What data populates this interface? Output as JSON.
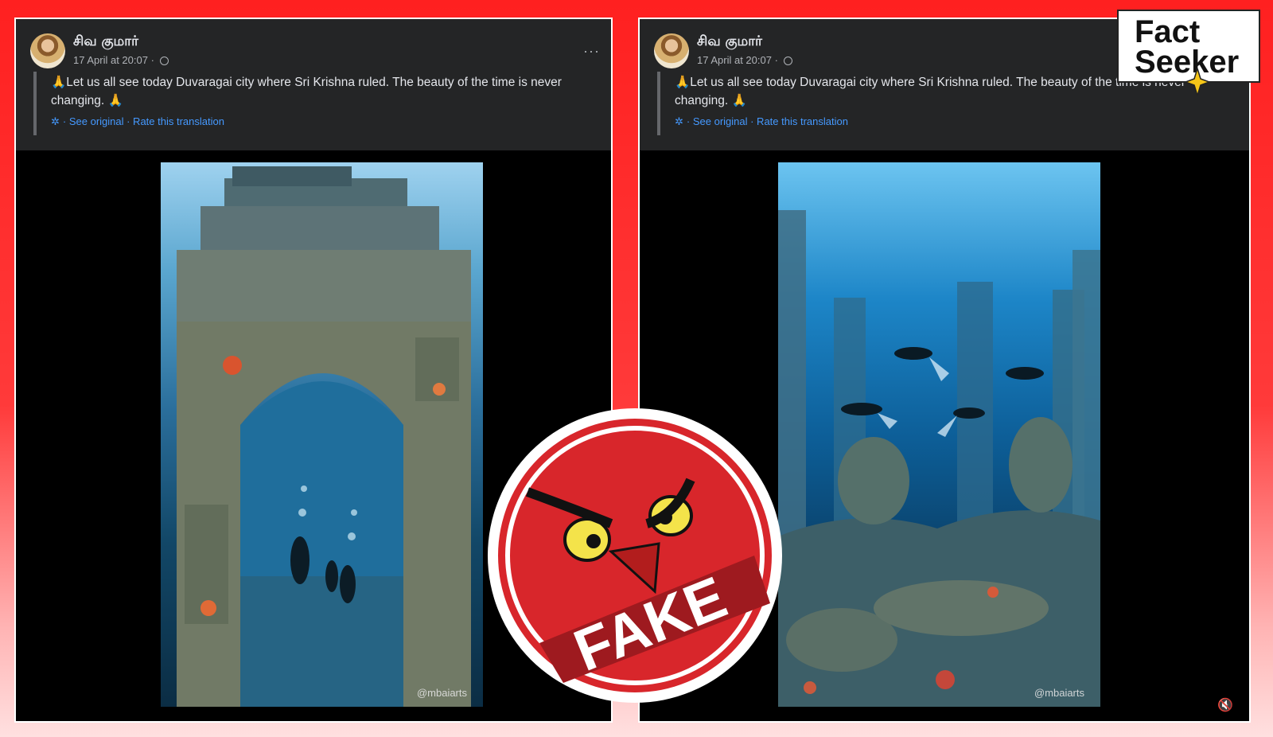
{
  "posts": [
    {
      "author": "சிவ குமார்",
      "timestamp": "17 April at 20:07 ·",
      "text": "🙏Let us all see today Duvaragai city where Sri Krishna ruled. The beauty of the time is never changing. 🙏",
      "translation": "· See original · Rate this translation",
      "more": "···",
      "watermark": "@mbaiarts"
    },
    {
      "author": "சிவ குமார்",
      "timestamp": "17 April at 20:07 ·",
      "text": "🙏Let us all see today Duvaragai city where Sri Krishna ruled. The beauty of the time is never changing. 🙏",
      "translation": "· See original · Rate this translation",
      "watermark": "@mbaiarts"
    }
  ],
  "logo": {
    "line1": "Fact",
    "line2": "Seeker"
  },
  "stamp": {
    "label": "FAKE"
  },
  "colors": {
    "background": "#ff2020",
    "panel": "#242526",
    "link": "#4599ff",
    "stamp": "#d8262b"
  },
  "icons": [
    "globe-icon",
    "gear-icon",
    "more-options-icon",
    "mute-icon",
    "star-icon"
  ]
}
